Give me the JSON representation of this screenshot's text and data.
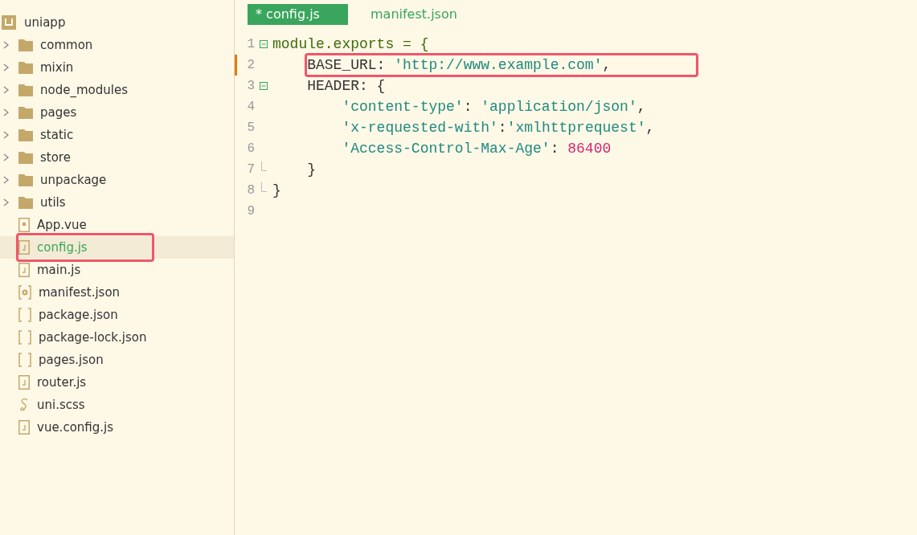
{
  "explorer": {
    "root": {
      "label": "uniapp"
    },
    "items": [
      {
        "label": "common",
        "kind": "folder",
        "selected": false,
        "highlighted": false
      },
      {
        "label": "mixin",
        "kind": "folder",
        "selected": false,
        "highlighted": false
      },
      {
        "label": "node_modules",
        "kind": "folder",
        "selected": false,
        "highlighted": false
      },
      {
        "label": "pages",
        "kind": "folder",
        "selected": false,
        "highlighted": false
      },
      {
        "label": "static",
        "kind": "folder",
        "selected": false,
        "highlighted": false
      },
      {
        "label": "store",
        "kind": "folder",
        "selected": false,
        "highlighted": false
      },
      {
        "label": "unpackage",
        "kind": "folder",
        "selected": false,
        "highlighted": false
      },
      {
        "label": "utils",
        "kind": "folder",
        "selected": false,
        "highlighted": false
      },
      {
        "label": "App.vue",
        "kind": "vue",
        "selected": false,
        "highlighted": false
      },
      {
        "label": "config.js",
        "kind": "js",
        "selected": true,
        "highlighted": true
      },
      {
        "label": "main.js",
        "kind": "js",
        "selected": false,
        "highlighted": false
      },
      {
        "label": "manifest.json",
        "kind": "settings",
        "selected": false,
        "highlighted": false
      },
      {
        "label": "package.json",
        "kind": "json",
        "selected": false,
        "highlighted": false
      },
      {
        "label": "package-lock.json",
        "kind": "json",
        "selected": false,
        "highlighted": false
      },
      {
        "label": "pages.json",
        "kind": "json",
        "selected": false,
        "highlighted": false
      },
      {
        "label": "router.js",
        "kind": "js",
        "selected": false,
        "highlighted": false
      },
      {
        "label": "uni.scss",
        "kind": "scss",
        "selected": false,
        "highlighted": false
      },
      {
        "label": "vue.config.js",
        "kind": "js",
        "selected": false,
        "highlighted": false
      }
    ]
  },
  "tabs": [
    {
      "label": "* config.js",
      "selected": true
    },
    {
      "label": "manifest.json",
      "selected": false
    }
  ],
  "editor": {
    "lines": [
      {
        "number": "1",
        "fold_start": true,
        "fold_end": false,
        "modified": false,
        "highlighted": false,
        "tokens": [
          {
            "kind": "kw",
            "text": "module.exports = {"
          }
        ]
      },
      {
        "number": "2",
        "fold_start": false,
        "fold_end": false,
        "modified": true,
        "highlighted": true,
        "tokens": [
          {
            "kind": "plain",
            "text": "    BASE_URL: "
          },
          {
            "kind": "str",
            "text": "'http://www.example.com'"
          },
          {
            "kind": "plain",
            "text": ","
          }
        ]
      },
      {
        "number": "3",
        "fold_start": true,
        "fold_end": false,
        "modified": false,
        "highlighted": false,
        "tokens": [
          {
            "kind": "plain",
            "text": "    HEADER: {"
          }
        ]
      },
      {
        "number": "4",
        "fold_start": false,
        "fold_end": false,
        "modified": false,
        "highlighted": false,
        "tokens": [
          {
            "kind": "str",
            "text": "        'content-type'"
          },
          {
            "kind": "plain",
            "text": ": "
          },
          {
            "kind": "str",
            "text": "'application/json'"
          },
          {
            "kind": "plain",
            "text": ","
          }
        ]
      },
      {
        "number": "5",
        "fold_start": false,
        "fold_end": false,
        "modified": false,
        "highlighted": false,
        "tokens": [
          {
            "kind": "str",
            "text": "        'x-requested-with'"
          },
          {
            "kind": "plain",
            "text": ":"
          },
          {
            "kind": "str",
            "text": "'xmlhttprequest'"
          },
          {
            "kind": "plain",
            "text": ","
          }
        ]
      },
      {
        "number": "6",
        "fold_start": false,
        "fold_end": false,
        "modified": false,
        "highlighted": false,
        "tokens": [
          {
            "kind": "str",
            "text": "        'Access-Control-Max-Age'"
          },
          {
            "kind": "plain",
            "text": ": "
          },
          {
            "kind": "num",
            "text": "86400"
          }
        ]
      },
      {
        "number": "7",
        "fold_start": false,
        "fold_end": true,
        "modified": false,
        "highlighted": false,
        "tokens": [
          {
            "kind": "plain",
            "text": "    }"
          }
        ]
      },
      {
        "number": "8",
        "fold_start": false,
        "fold_end": true,
        "modified": false,
        "highlighted": false,
        "tokens": [
          {
            "kind": "plain",
            "text": "}"
          }
        ]
      },
      {
        "number": "9",
        "fold_start": false,
        "fold_end": false,
        "modified": false,
        "highlighted": false
      }
    ]
  }
}
